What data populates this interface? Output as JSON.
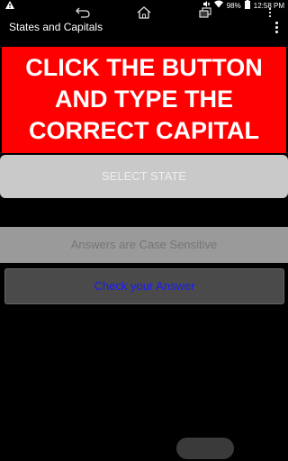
{
  "status_bar": {
    "battery_percent": "98%",
    "time": "12:58 PM",
    "icons": [
      "notification-icon",
      "mute-icon",
      "wifi-icon",
      "battery-icon"
    ]
  },
  "action_bar": {
    "title": "States and Capitals",
    "overflow_icon": "overflow-menu-icon"
  },
  "banner": {
    "text": "CLICK THE BUTTON AND TYPE THE CORRECT CAPITAL",
    "color": "#ff0000"
  },
  "select_state": {
    "label": "SELECT STATE"
  },
  "answer": {
    "placeholder": "Answers are Case Sensitive",
    "value": ""
  },
  "check": {
    "label": "Check your Answer",
    "label_color": "#1a1aff"
  },
  "nav_bar": {
    "icons": [
      "back-icon",
      "home-icon",
      "recent-apps-icon",
      "overflow-icon"
    ]
  }
}
